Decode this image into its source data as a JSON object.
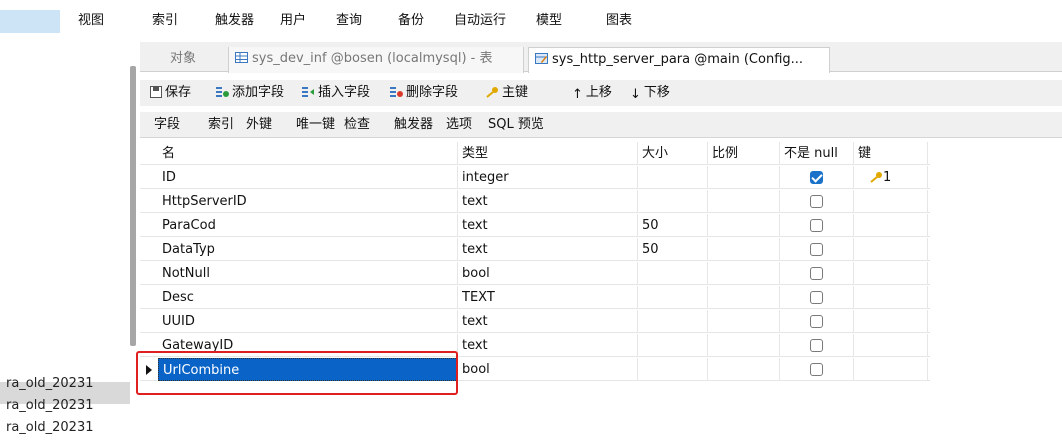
{
  "menu": {
    "items": [
      "视图",
      "索引",
      "触发器",
      "用户",
      "查询",
      "备份",
      "自动运行",
      "模型",
      "图表"
    ]
  },
  "left_panel": {
    "items": [
      "ra_old_20231",
      "ra_old_20231",
      "ra_old_20231"
    ]
  },
  "tabs": [
    {
      "label": "对象",
      "icon": "none",
      "active": false
    },
    {
      "label": "sys_dev_inf @bosen (localmysql) - 表",
      "icon": "table-icon",
      "active": false
    },
    {
      "label": "sys_http_server_para @main (Config...",
      "icon": "table-design-icon",
      "active": true
    }
  ],
  "toolbar": {
    "save": "保存",
    "add_field": "添加字段",
    "insert_field": "插入字段",
    "delete_field": "删除字段",
    "primary_key": "主键",
    "move_up": "上移",
    "move_down": "下移"
  },
  "subtabs": [
    "字段",
    "索引",
    "外键",
    "唯一键",
    "检查",
    "触发器",
    "选项",
    "SQL 预览"
  ],
  "grid": {
    "headers": {
      "name": "名",
      "type": "类型",
      "size": "大小",
      "scale": "比例",
      "not_null": "不是 null",
      "key": "键"
    },
    "rows": [
      {
        "name": "ID",
        "type": "integer",
        "size": "",
        "scale": "",
        "not_null": true,
        "key": "1"
      },
      {
        "name": "HttpServerID",
        "type": "text",
        "size": "",
        "scale": "",
        "not_null": false,
        "key": ""
      },
      {
        "name": "ParaCod",
        "type": "text",
        "size": "50",
        "scale": "",
        "not_null": false,
        "key": ""
      },
      {
        "name": "DataTyp",
        "type": "text",
        "size": "50",
        "scale": "",
        "not_null": false,
        "key": ""
      },
      {
        "name": "NotNull",
        "type": "bool",
        "size": "",
        "scale": "",
        "not_null": false,
        "key": ""
      },
      {
        "name": "Desc",
        "type": "TEXT",
        "size": "",
        "scale": "",
        "not_null": false,
        "key": ""
      },
      {
        "name": "UUID",
        "type": "text",
        "size": "",
        "scale": "",
        "not_null": false,
        "key": ""
      },
      {
        "name": "GatewayID",
        "type": "text",
        "size": "",
        "scale": "",
        "not_null": false,
        "key": ""
      },
      {
        "name": "UrlCombine",
        "type": "bool",
        "size": "",
        "scale": "",
        "not_null": false,
        "key": ""
      }
    ],
    "selected_row": 8
  },
  "colors": {
    "accent": "#0a64c8",
    "highlight_box": "#e02020",
    "key_icon": "#e0a800"
  }
}
